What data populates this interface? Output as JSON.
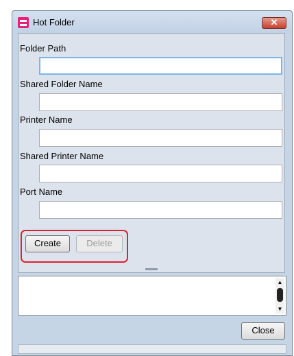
{
  "window": {
    "title": "Hot Folder",
    "close_glyph": "✕",
    "icon": "hot-folder-app-icon"
  },
  "form": {
    "fields": [
      {
        "label": "Folder Path",
        "value": "",
        "focused": true
      },
      {
        "label": "Shared Folder Name",
        "value": ""
      },
      {
        "label": "Printer Name",
        "value": ""
      },
      {
        "label": "Shared Printer Name",
        "value": ""
      },
      {
        "label": "Port Name",
        "value": ""
      }
    ],
    "create_label": "Create",
    "delete_label": "Delete"
  },
  "log": {
    "text": ""
  },
  "footer": {
    "close_label": "Close"
  },
  "colors": {
    "highlight": "#e0202d",
    "window_bg": "#c6d5e6",
    "title_close": "#c7432e"
  }
}
